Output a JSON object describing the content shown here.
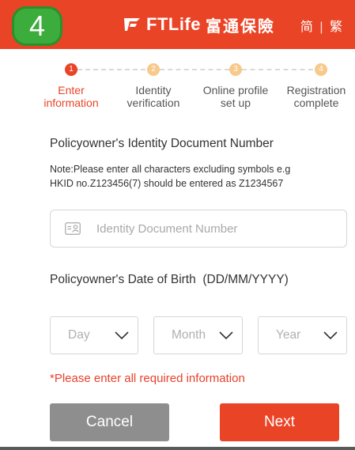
{
  "badge": "4",
  "header": {
    "logo_text": "FTLife",
    "logo_chinese": "富通保險",
    "lang_simplified": "简",
    "lang_separator": "|",
    "lang_traditional": "繁"
  },
  "steps": [
    {
      "number": "1",
      "label_line1": "Enter",
      "label_line2": "information",
      "active": true
    },
    {
      "number": "2",
      "label_line1": "Identity",
      "label_line2": "verification",
      "active": false
    },
    {
      "number": "3",
      "label_line1": "Online profile",
      "label_line2": "set up",
      "active": false
    },
    {
      "number": "4",
      "label_line1": "Registration",
      "label_line2": "complete",
      "active": false
    }
  ],
  "form": {
    "id_title": "Policyowner's Identity Document Number",
    "note_line1": "Note:Please enter all characters excluding symbols e.g",
    "note_line2": "HKID no.Z123456(7) should be entered as Z1234567",
    "id_placeholder": "Identity Document Number",
    "id_value": "",
    "dob_title": "Policyowner's Date of Birth  (DD/MM/YYYY)",
    "day_label": "Day",
    "month_label": "Month",
    "year_label": "Year",
    "error": "*Please enter all required information"
  },
  "buttons": {
    "cancel": "Cancel",
    "next": "Next"
  },
  "colors": {
    "brand": "#ea4426",
    "pending_step": "#f7c98a",
    "cancel_button": "#8e8e8e",
    "badge": "#3cad3c"
  }
}
